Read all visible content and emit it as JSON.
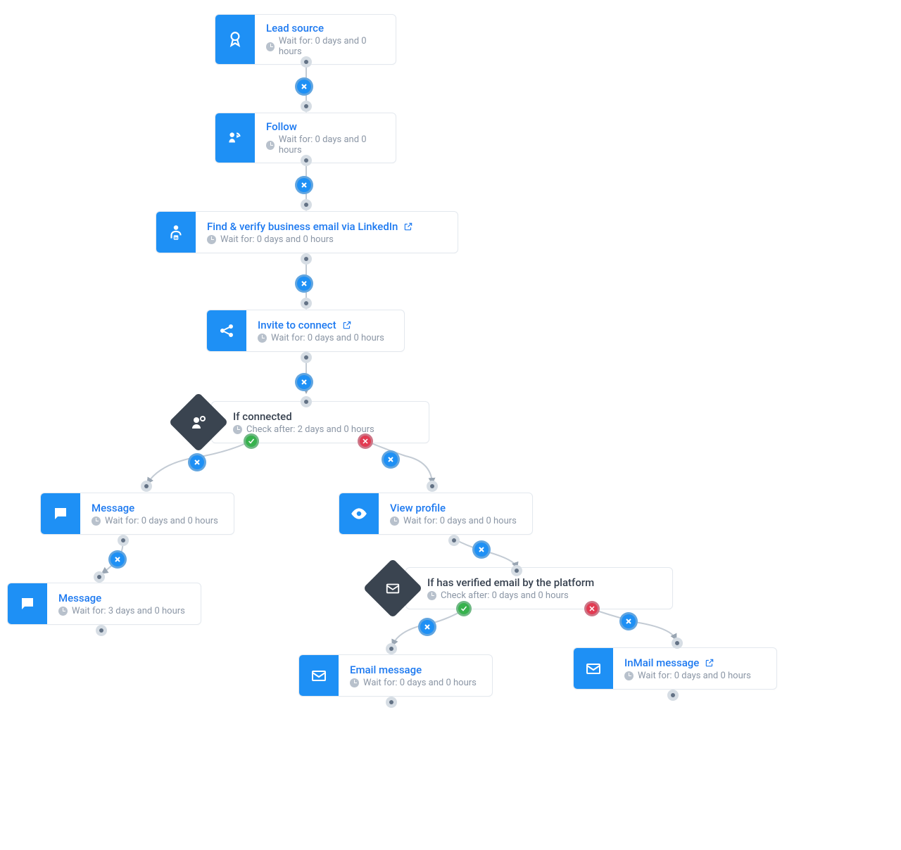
{
  "nodes": {
    "lead": {
      "title": "Lead source",
      "wait": "Wait for: 0 days and 0 hours"
    },
    "follow": {
      "title": "Follow",
      "wait": "Wait for: 0 days and 0 hours"
    },
    "find": {
      "title": "Find & verify business email via LinkedIn",
      "wait": "Wait for: 0 days and 0 hours"
    },
    "invite": {
      "title": "Invite to connect",
      "wait": "Wait for: 0 days and 0 hours"
    },
    "ifconn": {
      "title": "If connected",
      "wait": "Check after: 2 days and 0 hours"
    },
    "msg1": {
      "title": "Message",
      "wait": "Wait for: 0 days and 0 hours"
    },
    "msg2": {
      "title": "Message",
      "wait": "Wait for: 3 days and 0 hours"
    },
    "view": {
      "title": "View profile",
      "wait": "Wait for: 0 days and 0 hours"
    },
    "ifemail": {
      "title": "If has verified email by the platform",
      "wait": "Check after: 0 days and 0 hours"
    },
    "email": {
      "title": "Email message",
      "wait": "Wait for: 0 days and 0 hours"
    },
    "inmail": {
      "title": "InMail message",
      "wait": "Wait for: 0 days and 0 hours"
    }
  }
}
